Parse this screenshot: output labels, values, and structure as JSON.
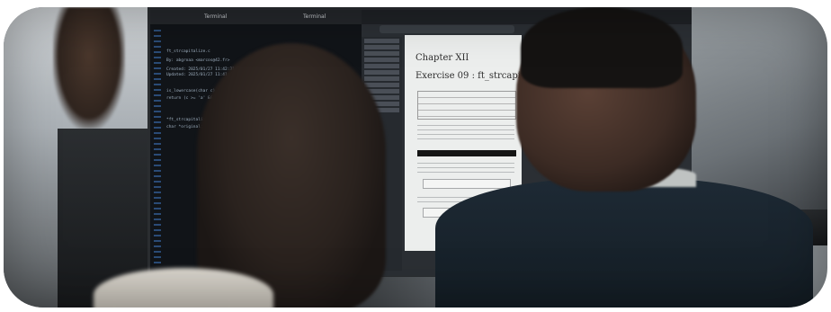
{
  "terminal": {
    "tab_left": "Terminal",
    "tab_right": "Terminal",
    "lines": [
      "ft_strcapitalize.c",
      "By: abgroaa  <marcos@42.fr>",
      "Created: 2025/01/27 11:42:31 by mdgrdaci",
      "Updated: 2025/01/27 11:41:41 by mdgrdaci",
      "is_lowercase(char c)",
      "return (c >= 'a' && c <= 'z');",
      "*ft_strcapitalize(char *str)",
      "char   *original;"
    ]
  },
  "pdf": {
    "chapter": "Chapter XII",
    "exercise": "Exercise 09 : ft_strcapitalize"
  }
}
